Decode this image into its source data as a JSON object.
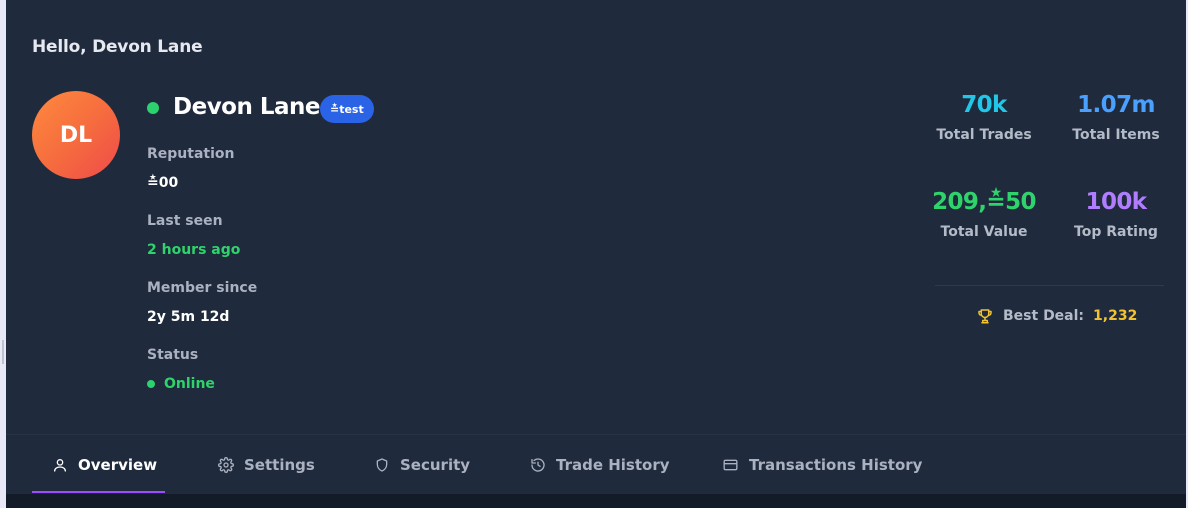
{
  "greeting": "Hello, Devon Lane",
  "profile": {
    "initials": "DL",
    "name": "Devon Lane",
    "badge": "≛test",
    "avatar_gradient": [
      "#ff8a3d",
      "#ef4a4a"
    ],
    "presence_color": "#2bd26e"
  },
  "info": {
    "reputation_label": "Reputation",
    "reputation_value": "≛00",
    "last_seen_label": "Last seen",
    "last_seen_value": "2 hours ago",
    "member_since_label": "Member since",
    "member_since_value": "2y 5m 12d",
    "status_label": "Status",
    "status_value": "Online"
  },
  "stats": [
    {
      "value": "70k",
      "label": "Total Trades",
      "color": "#22c7e8"
    },
    {
      "value": "1.07m",
      "label": "Total Items",
      "color": "#4aa0ff"
    },
    {
      "value": "209,≛50",
      "label": "Total Value",
      "color": "#2fd36c"
    },
    {
      "value": "100k",
      "label": "Top Rating",
      "color": "#b07dff"
    }
  ],
  "best_deal": {
    "icon": "trophy-icon",
    "label": "Best Deal:",
    "value": "1,232",
    "color": "#f2c230"
  },
  "tabs": [
    {
      "label": "Overview",
      "icon": "user-icon",
      "active": true
    },
    {
      "label": "Settings",
      "icon": "gear-icon",
      "active": false
    },
    {
      "label": "Security",
      "icon": "shield-icon",
      "active": false
    },
    {
      "label": "Trade History",
      "icon": "history-icon",
      "active": false
    },
    {
      "label": "Transactions History",
      "icon": "credit-card-icon",
      "active": false
    }
  ],
  "accent_color": "#9b4dff"
}
